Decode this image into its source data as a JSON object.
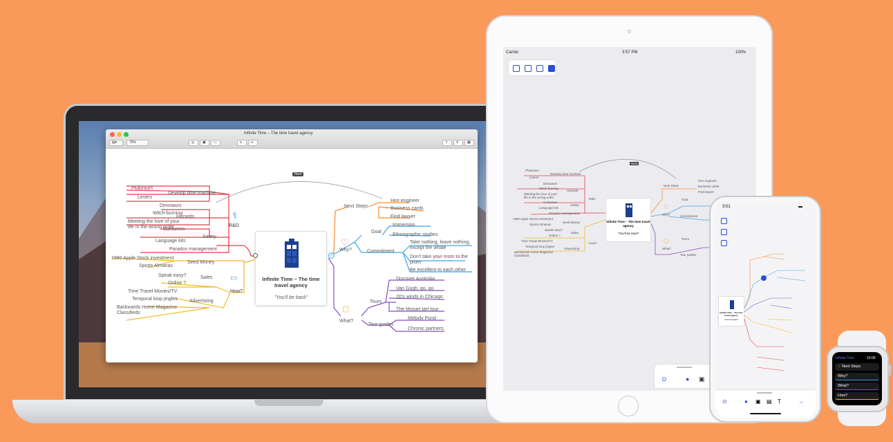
{
  "mac": {
    "window_title": "Infinite Time – The time travel agency",
    "zoom": "75%",
    "center_title": "Infinite Time – The time travel agency",
    "center_subtitle": "\"You'll be back\"",
    "connection_label": "Next",
    "rd": {
      "label": "R&D",
      "hazards": "Hazards",
      "develop": "Develop time machine",
      "plutonium": "Plutonium",
      "levers": "Levers",
      "dinosaurs": "Dinosaurs",
      "witch": "Witch-burning",
      "meeting": "Meeting the love of your life in the wrong order",
      "safety": "Safety",
      "costumes": "Costumes",
      "language": "Language kits",
      "paradox": "Paradox management"
    },
    "how": {
      "label": "How?",
      "seed": "Seed Money",
      "apple": "1980 Apple Stock investment",
      "sports": "Sports Almanac",
      "sales": "Sales",
      "speak": "Speak easy?",
      "online": "Online ?",
      "advertising": "Advertising",
      "ttmovies": "Time Travel Movies/TV",
      "temporal": "Temporal loop jingles",
      "backwards": "Backwards Home Magazine Classifieds"
    },
    "next": {
      "label": "Next Steps",
      "hire": "Hire engineer",
      "cards": "Business cards",
      "lawyer": "Find lawyer"
    },
    "why": {
      "label": "Why?",
      "goal": "Goal",
      "immersion": "Immersion",
      "ethno": "Ethnographic studies",
      "commitment": "Commitment",
      "take": "Take nothing, leave nothing, except the whale",
      "dont": "Don't take your mom to the prom",
      "excellent": "Be excellent to each other"
    },
    "what": {
      "label": "What?",
      "tours": "Tours",
      "discover": "Discover Australia",
      "vangogh": "Van Gogh, go, go",
      "twenties": "20's winds in Chicago",
      "mozart": "The Mozart tart tour",
      "tourguides": "Tour guides",
      "melody": "Melody Pond",
      "chronic": "Chronic partners"
    }
  },
  "ipad": {
    "carrier": "Carrier",
    "time": "3:57 PM",
    "battery": "100%",
    "center_title": "Infinite Time – The time travel agency",
    "center_subtitle": "\"You'll be back\"",
    "labels": {
      "plutonium": "Plutonium",
      "levers": "Levers",
      "develop": "Develop time machine",
      "dinosaurs": "Dinosaurs",
      "witch": "Witch-burning",
      "meeting": "Meeting the love of your life in the wrong order",
      "hazards": "Hazards",
      "costumes": "Costumes",
      "language": "Language kits",
      "safety": "Safety",
      "paradox": "Paradox management",
      "rd": "R&D",
      "apple": "1980 Apple Stock investment",
      "seed": "Seed Money",
      "sports": "Sports Almanac",
      "speak": "Speak easy?",
      "sales": "Sales",
      "online": "Online ?",
      "ttmovies": "Time Travel Movies/TV",
      "temporal": "Temporal loop jingles",
      "advertising": "Advertising",
      "backwards": "Backwards Home Magazine Classifieds",
      "how": "How?",
      "next": "Next Steps",
      "hire": "Hire engineer",
      "cards": "Business cards",
      "lawyer": "Find lawyer",
      "goal": "Goal",
      "why": "Why?",
      "commitment": "Commitment",
      "what": "What?",
      "tours": "Tours",
      "tourguides": "Tour guides"
    }
  },
  "iphone": {
    "time": "3:01",
    "center_title": "Infinite Time – The time travel agency",
    "center_subtitle": "\"You'll be back\""
  },
  "watch": {
    "title": "Infinite Time",
    "time": "10:09",
    "rows": [
      "Next Steps",
      "Why?",
      "What?",
      "How?"
    ]
  }
}
